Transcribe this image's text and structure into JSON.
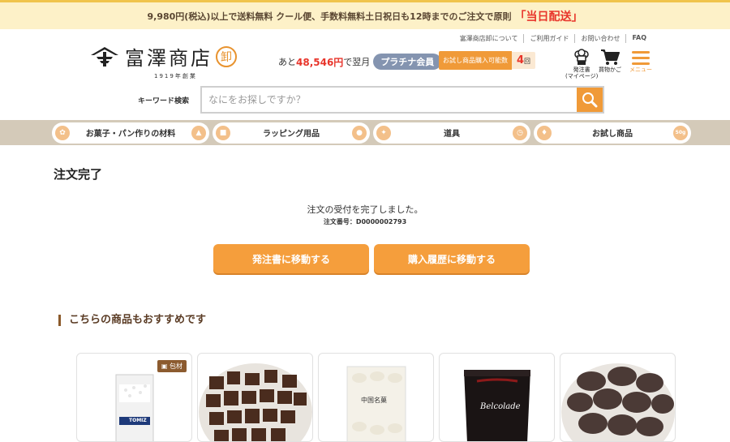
{
  "topbar": {
    "text": "9,980円(税込)以上で送料無料 クール便、手数料無料土日祝日も12時までのご注文で原則",
    "highlight": "「当日配送」"
  },
  "util_links": [
    "富澤商店卸について",
    "ご利用ガイド",
    "お問い合わせ",
    "FAQ"
  ],
  "logo": {
    "name": "富澤商店",
    "seal": "卸",
    "sub": "1919年創業"
  },
  "member": {
    "prefix": "あと",
    "amount": "48,546円",
    "suffix": "で翌月",
    "rank": "プラチナ会員"
  },
  "trial": {
    "label": "お試し商品購入可能数",
    "count": "4",
    "unit": "回"
  },
  "header_icons": {
    "order_line1": "発注書",
    "order_line2": "(マイページ)",
    "cart": "買物かご",
    "menu": "メニュー"
  },
  "search": {
    "label": "キーワード検索",
    "placeholder": "なにをお探しですか？"
  },
  "categories": [
    "お菓子・パン作りの材料",
    "ラッピング用品",
    "道具",
    "お試し商品"
  ],
  "trial_badge": "50g",
  "main": {
    "title": "注文完了",
    "message": "注文の受付を完了しました。",
    "order_number": "注文番号：D0000002793",
    "btn_order": "発注書に移動する",
    "btn_history": "購入履歴に移動する"
  },
  "recommend": {
    "title": "こちらの商品もおすすめです",
    "tag": "包材",
    "product_labels": [
      "TOMIZ",
      "中国名菓",
      "Belcolade"
    ]
  },
  "colors": {
    "accent": "#f59e3c",
    "topbar_bg": "#fdf1c8",
    "nav_bg": "#d4cab9",
    "price_red": "#e8352b"
  }
}
